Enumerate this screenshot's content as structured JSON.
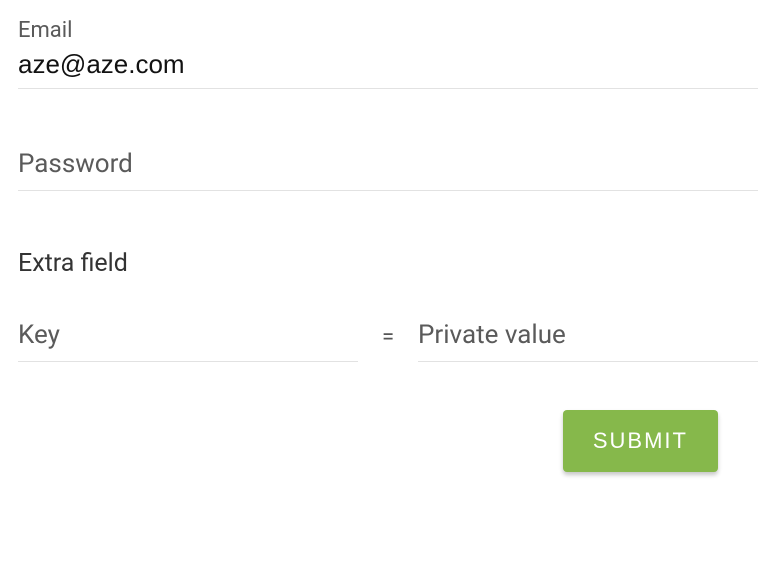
{
  "form": {
    "email": {
      "label": "Email",
      "value": "aze@aze.com"
    },
    "password": {
      "label": "Password",
      "value": ""
    },
    "extra": {
      "heading": "Extra field",
      "key": {
        "label": "Key",
        "value": ""
      },
      "separator": "=",
      "private": {
        "label": "Private value",
        "value": ""
      }
    },
    "submit_label": "SUBMIT"
  },
  "colors": {
    "accent": "#86b84b",
    "label": "#5a5a5a",
    "underline": "#e2e2e2"
  }
}
